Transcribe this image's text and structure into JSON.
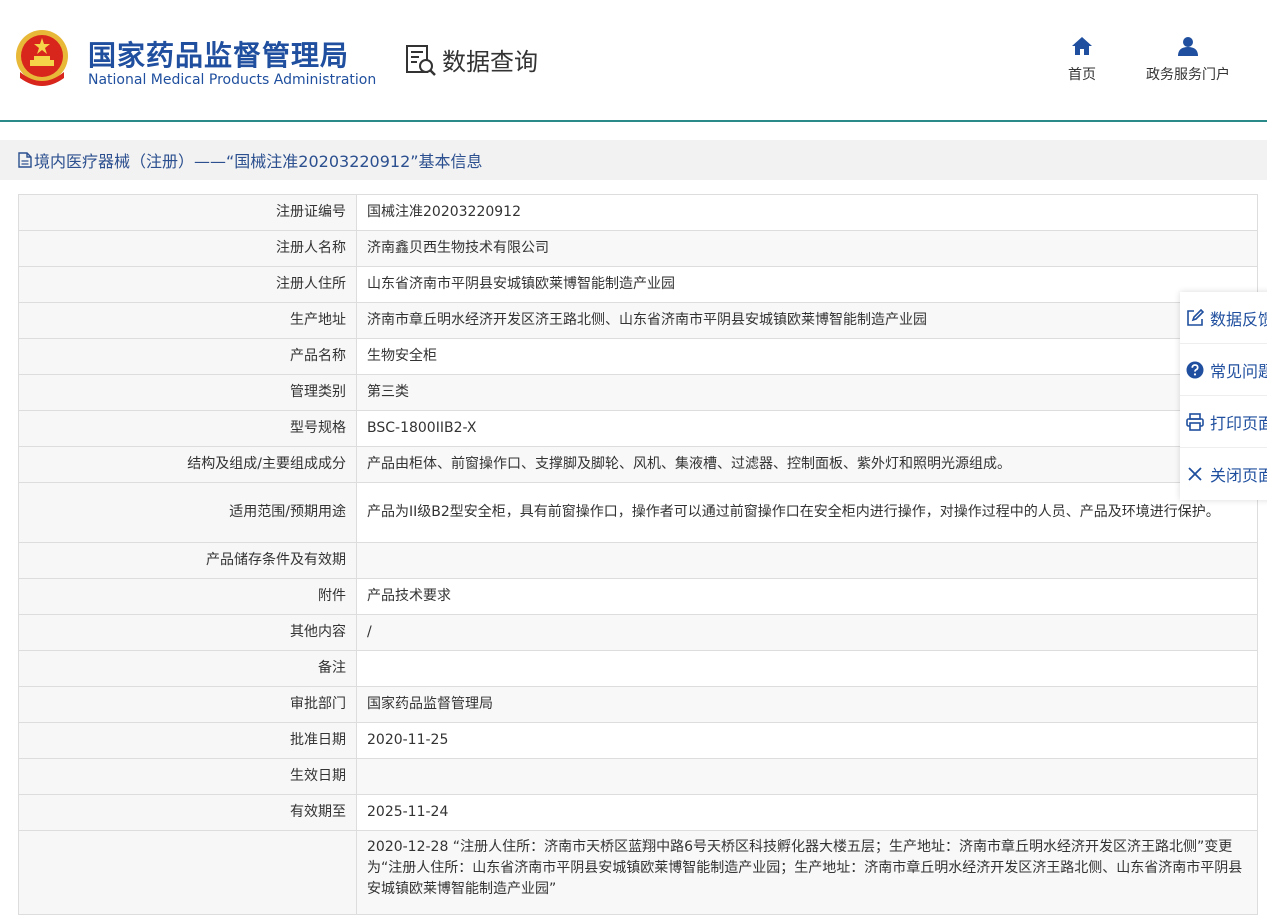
{
  "header": {
    "org_cn": "国家药品监督管理局",
    "org_en": "National Medical Products Administration",
    "query_title": "数据查询",
    "nav": [
      {
        "label": "首页",
        "icon": "home-icon"
      },
      {
        "label": "政务服务门户",
        "icon": "user-icon"
      }
    ]
  },
  "breadcrumb": "境内医疗器械（注册）——“国械注准20203220912”基本信息",
  "rows": [
    {
      "key": "注册证编号",
      "value": "国械注准20203220912"
    },
    {
      "key": "注册人名称",
      "value": "济南鑫贝西生物技术有限公司"
    },
    {
      "key": "注册人住所",
      "value": "山东省济南市平阴县安城镇欧莱博智能制造产业园"
    },
    {
      "key": "生产地址",
      "value": "济南市章丘明水经济开发区济王路北侧、山东省济南市平阴县安城镇欧莱博智能制造产业园"
    },
    {
      "key": "产品名称",
      "value": "生物安全柜"
    },
    {
      "key": "管理类别",
      "value": "第三类"
    },
    {
      "key": "型号规格",
      "value": "BSC-1800IIB2-X"
    },
    {
      "key": "结构及组成/主要组成成分",
      "value": "产品由柜体、前窗操作口、支撑脚及脚轮、风机、集液槽、过滤器、控制面板、紫外灯和照明光源组成。"
    },
    {
      "key": "适用范围/预期用途",
      "value": "产品为II级B2型安全柜，具有前窗操作口，操作者可以通过前窗操作口在安全柜内进行操作，对操作过程中的人员、产品及环境进行保护。"
    },
    {
      "key": "产品储存条件及有效期",
      "value": ""
    },
    {
      "key": "附件",
      "value": "产品技术要求"
    },
    {
      "key": "其他内容",
      "value": "/"
    },
    {
      "key": "备注",
      "value": ""
    },
    {
      "key": "审批部门",
      "value": "国家药品监督管理局"
    },
    {
      "key": "批准日期",
      "value": "2020-11-25"
    },
    {
      "key": "生效日期",
      "value": ""
    },
    {
      "key": "有效期至",
      "value": "2025-11-24"
    },
    {
      "key": "",
      "value": "2020-12-28 “注册人住所：济南市天桥区蓝翔中路6号天桥区科技孵化器大楼五层；生产地址：济南市章丘明水经济开发区济王路北侧”变更为“注册人住所：山东省济南市平阴县安城镇欧莱博智能制造产业园；生产地址：济南市章丘明水经济开发区济王路北侧、山东省济南市平阴县安城镇欧莱博智能制造产业园”"
    }
  ],
  "side": [
    {
      "label": "数据反馈",
      "icon": "edit-icon"
    },
    {
      "label": "常见问题",
      "icon": "question-icon"
    },
    {
      "label": "打印页面",
      "icon": "print-icon"
    },
    {
      "label": "关闭页面",
      "icon": "close-icon"
    }
  ],
  "colors": {
    "brand": "#1f4f9e",
    "divider": "#2a8a8a"
  }
}
